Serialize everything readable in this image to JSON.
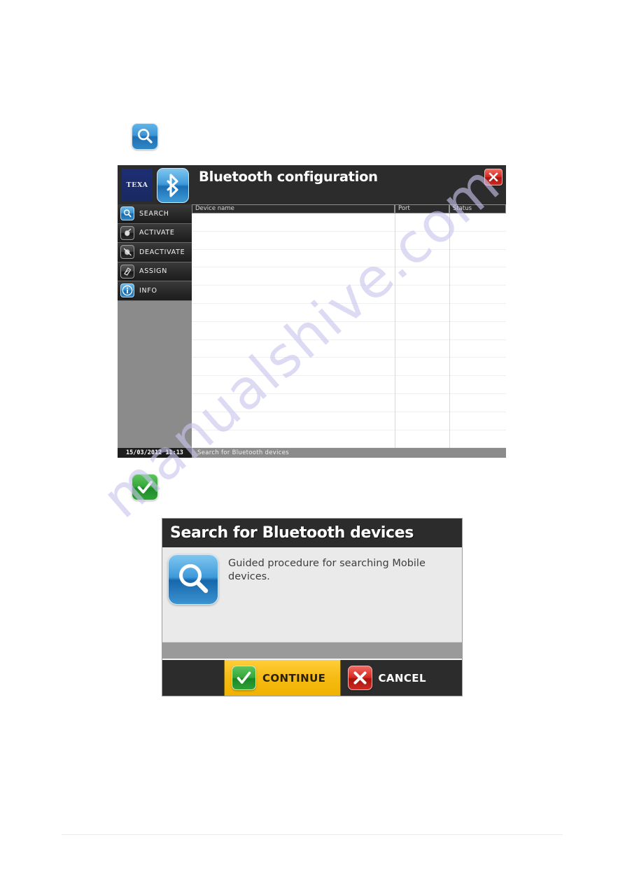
{
  "page": {
    "watermark_text": "manualshive.com"
  },
  "standalone_icons": {
    "search": "search-icon",
    "check": "check-icon"
  },
  "app_window": {
    "title": "Bluetooth configuration",
    "close_label": "×",
    "brand": {
      "logo_text": "TEXA",
      "bluetooth_icon": "bluetooth-icon"
    },
    "sidebar": {
      "items": [
        {
          "label": "SEARCH",
          "icon": "search-icon",
          "icon_style": "blue"
        },
        {
          "label": "ACTIVATE",
          "icon": "hand-pointer-icon",
          "icon_style": "dark"
        },
        {
          "label": "DEACTIVATE",
          "icon": "hand-deactivate-icon",
          "icon_style": "dark"
        },
        {
          "label": "ASSIGN",
          "icon": "assign-tag-icon",
          "icon_style": "dark"
        },
        {
          "label": "INFO",
          "icon": "info-icon",
          "icon_style": "blue"
        }
      ]
    },
    "table": {
      "columns": [
        "Device name",
        "Port",
        "Status"
      ],
      "rows": [],
      "empty_row_count": 13
    },
    "statusbar": {
      "datetime": "15/03/2012 11:13",
      "message": "Search for Bluetooth devices"
    }
  },
  "dialog": {
    "title": "Search for Bluetooth devices",
    "icon": "search-icon",
    "message": "Guided procedure for searching Mobile devices.",
    "buttons": [
      {
        "label": "CONTINUE",
        "icon": "check-icon",
        "state": "highlighted"
      },
      {
        "label": "CANCEL",
        "icon": "close-x-icon",
        "state": "normal"
      }
    ]
  },
  "colors": {
    "titlebar": "#2c2c2c",
    "sidebar_empty": "#8b8b8b",
    "accent_blue": "#3f9ada",
    "brand_navy": "#1d2f74",
    "continue_yellow": "#f6bb13",
    "danger_red": "#d62b22",
    "success_green": "#35a83a",
    "watermark": "#c9c6ee"
  }
}
